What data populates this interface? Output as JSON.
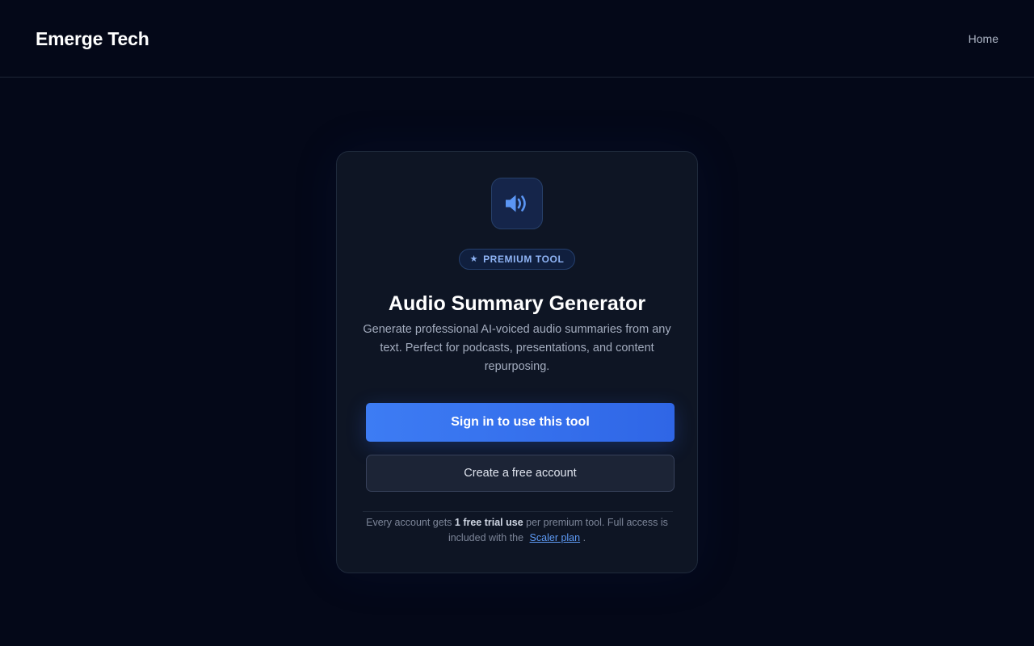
{
  "header": {
    "brand": "Emerge Tech",
    "nav": {
      "home_label": "Home"
    }
  },
  "card": {
    "icon": "speaker-volume-icon",
    "badge": {
      "icon": "star-icon",
      "label": "PREMIUM TOOL"
    },
    "title": "Audio Summary Generator",
    "description": "Generate professional AI-voiced audio summaries from any text. Perfect for podcasts, presentations, and content repurposing.",
    "primary_button_label": "Sign in to use this tool",
    "secondary_button_label": "Create a free account",
    "footnote": {
      "prefix": "Every account gets ",
      "highlight": "1 free trial use",
      "middle": " per premium tool. Full access is included with the ",
      "link_label": "Scaler plan",
      "suffix": " ."
    }
  },
  "colors": {
    "background": "#040818",
    "card_background": "#0e1524",
    "accent": "#3d7cf4",
    "badge_text": "#8fb4f5",
    "link": "#5e9af5"
  }
}
